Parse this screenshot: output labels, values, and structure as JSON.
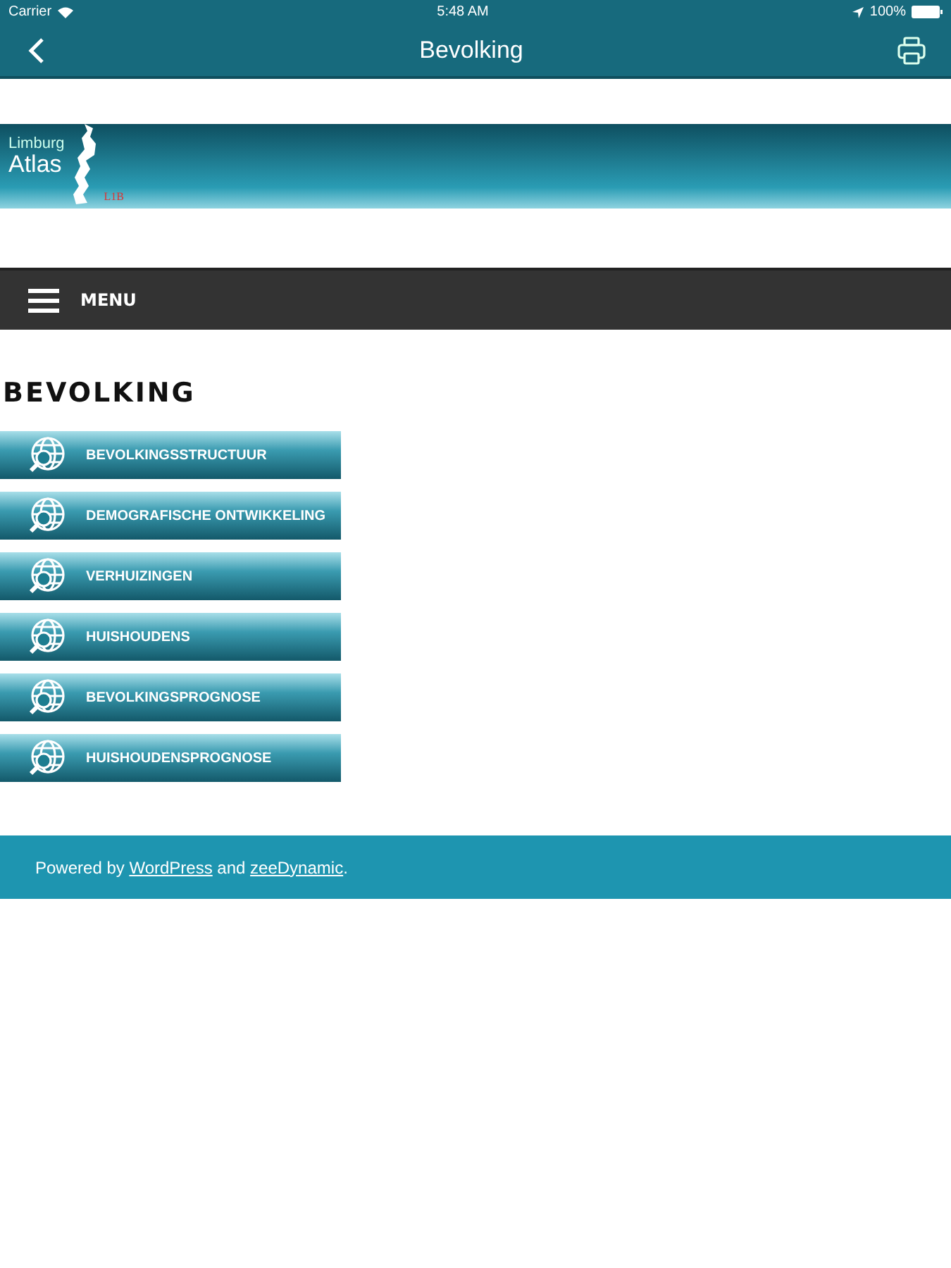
{
  "status_bar": {
    "carrier": "Carrier",
    "time": "5:48 AM",
    "battery": "100%"
  },
  "nav_bar": {
    "title": "Bevolking"
  },
  "banner": {
    "line_1": "Limburg",
    "line_2": "Atlas",
    "tag": "L1B"
  },
  "menu_bar": {
    "label": "MENU"
  },
  "heading": "BEVOLKING",
  "buttons": [
    {
      "label": "BEVOLKINGSSTRUCTUUR"
    },
    {
      "label": "DEMOGRAFISCHE ONTWIKKELING"
    },
    {
      "label": "VERHUIZINGEN"
    },
    {
      "label": "HUISHOUDENS"
    },
    {
      "label": "BEVOLKINGSPROGNOSE"
    },
    {
      "label": "HUISHOUDENSPROGNOSE"
    }
  ],
  "footer": [
    {
      "kind": "text",
      "text": "Powered by "
    },
    {
      "kind": "link",
      "text": "WordPress"
    },
    {
      "kind": "text",
      "text": " and "
    },
    {
      "kind": "link",
      "text": "zeeDynamic"
    },
    {
      "kind": "text",
      "text": "."
    }
  ]
}
